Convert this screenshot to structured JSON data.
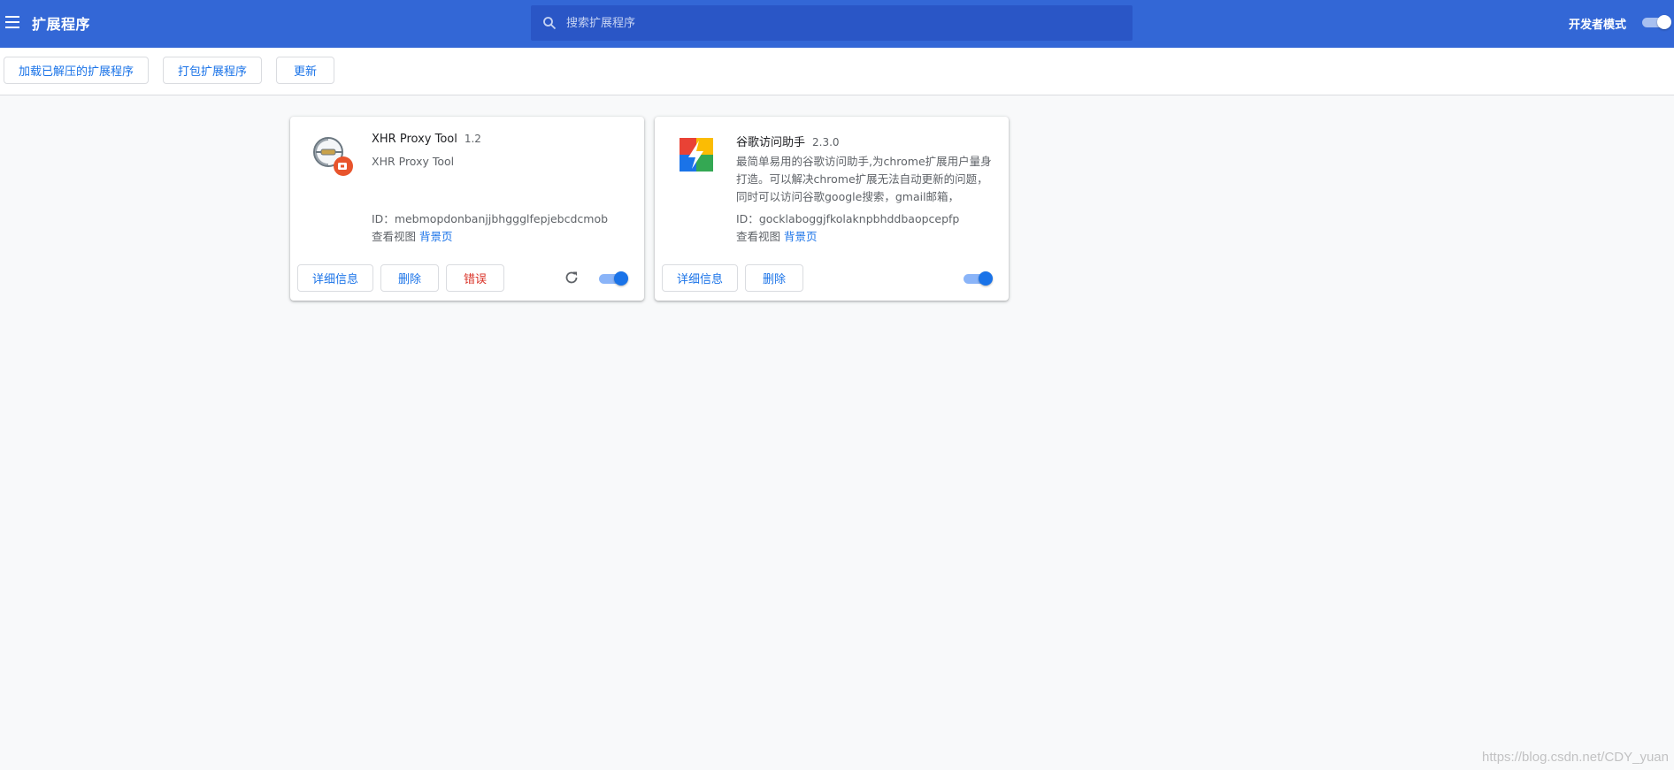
{
  "app": {
    "title": "扩展程序",
    "search_placeholder": "搜索扩展程序",
    "dev_mode_label": "开发者模式",
    "dev_mode_on": true
  },
  "toolbar": {
    "load_unpacked": "加载已解压的扩展程序",
    "pack": "打包扩展程序",
    "update": "更新"
  },
  "extensions": [
    {
      "name": "XHR Proxy Tool",
      "version": "1.2",
      "description": "XHR Proxy Tool",
      "id_label": "ID：",
      "id": "mebmopdonbanjjbhggglfepjebcdcmob",
      "views_label": "查看视图",
      "views_link": "背景页",
      "details_label": "详细信息",
      "remove_label": "删除",
      "errors_label": "错误",
      "enabled": true,
      "icon": "xhr-proxy-icon"
    },
    {
      "name": "谷歌访问助手",
      "version": "2.3.0",
      "description": "最简单易用的谷歌访问助手,为chrome扩展用户量身打造。可以解决chrome扩展无法自动更新的问题，同时可以访问谷歌google搜索，gmail邮箱，",
      "id_label": "ID：",
      "id": "gocklaboggjfkolaknpbhddbaopcepfp",
      "views_label": "查看视图",
      "views_link": "背景页",
      "details_label": "详细信息",
      "remove_label": "删除",
      "enabled": true,
      "icon": "google-access-helper-icon"
    }
  ],
  "watermark": "https://blog.csdn.net/CDY_yuan",
  "colors": {
    "header": "#3367d6",
    "search": "#2a56c6",
    "accent": "#1a73e8",
    "error": "#d93025"
  }
}
